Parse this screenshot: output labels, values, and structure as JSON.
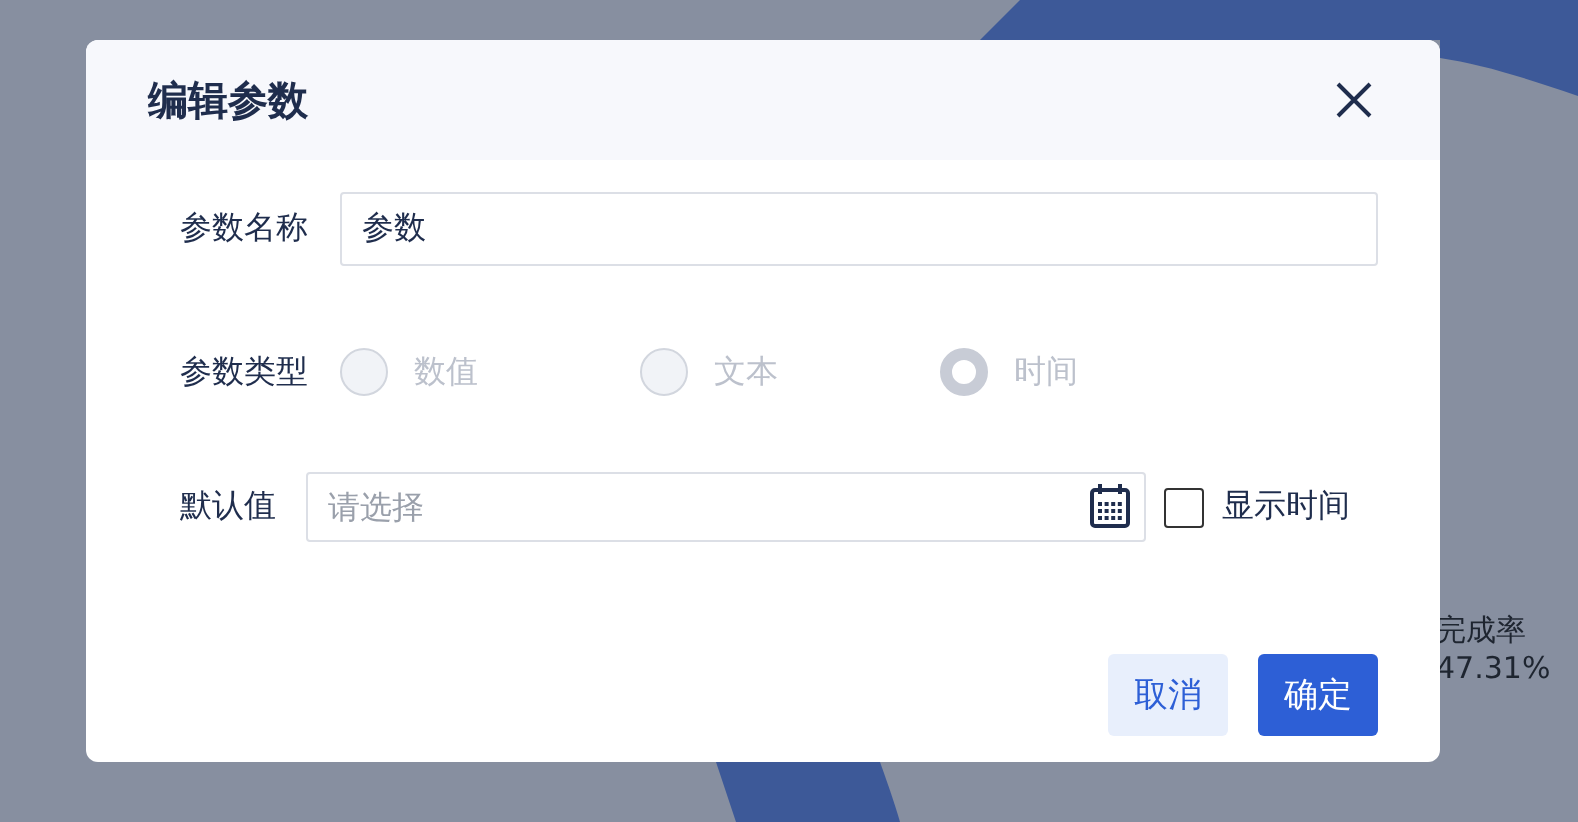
{
  "background": {
    "metric_label": "完成率",
    "metric_value": "47.31%"
  },
  "dialog": {
    "title": "编辑参数",
    "name_field": {
      "label": "参数名称",
      "value": "参数"
    },
    "type_field": {
      "label": "参数类型",
      "options": [
        {
          "label": "数值",
          "selected": false,
          "disabled": true
        },
        {
          "label": "文本",
          "selected": false,
          "disabled": true
        },
        {
          "label": "时间",
          "selected": true,
          "disabled": true
        }
      ]
    },
    "default_field": {
      "label": "默认值",
      "placeholder": "请选择",
      "show_time": {
        "label": "显示时间",
        "checked": false
      }
    },
    "buttons": [
      {
        "label": "取消",
        "kind": "secondary"
      },
      {
        "label": "确定",
        "kind": "primary"
      }
    ]
  }
}
